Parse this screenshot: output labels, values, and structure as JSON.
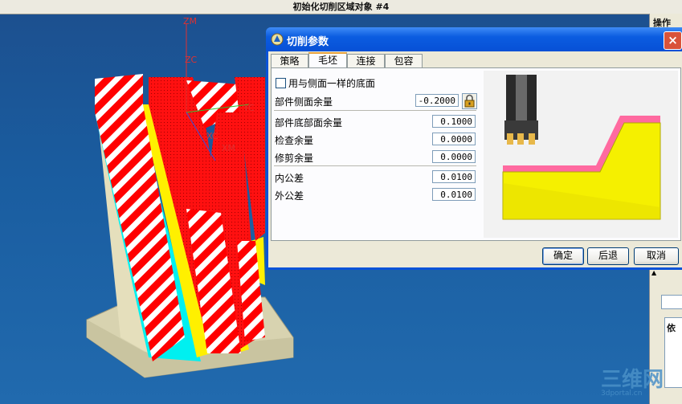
{
  "window": {
    "title": "初始化切削区域对象 #4"
  },
  "viewport": {
    "axes": {
      "zm": "ZM",
      "zc": "ZC",
      "yc": "YC",
      "xc": "XC",
      "xm": "XM"
    }
  },
  "right_panel": {
    "title": "操作",
    "tree_label": "依"
  },
  "dialog": {
    "title": "切削参数",
    "tabs": [
      {
        "label": "策略",
        "active": false
      },
      {
        "label": "毛坯",
        "active": true
      },
      {
        "label": "连接",
        "active": false
      },
      {
        "label": "包容",
        "active": false
      }
    ],
    "same_floor_checkbox": {
      "label": "用与侧面一样的底面",
      "checked": false
    },
    "fields": {
      "part_side_stock": {
        "label": "部件侧面余量",
        "value": "-0.2000"
      },
      "part_floor_stock": {
        "label": "部件底部面余量",
        "value": "0.1000"
      },
      "check_stock": {
        "label": "检查余量",
        "value": "0.0000"
      },
      "trim_stock": {
        "label": "修剪余量",
        "value": "0.0000"
      },
      "intol": {
        "label": "内公差",
        "value": "0.0100"
      },
      "outtol": {
        "label": "外公差",
        "value": "0.0100"
      }
    },
    "buttons": {
      "ok": "确定",
      "back": "后退",
      "cancel": "取消"
    },
    "colors": {
      "stock": "#ff6aa0",
      "part": "#f5f000",
      "tool_holder": "#2a2a2a",
      "insert": "#e8b84a"
    }
  },
  "watermark": {
    "main": "三维网",
    "sub": "3dportal.cn"
  }
}
